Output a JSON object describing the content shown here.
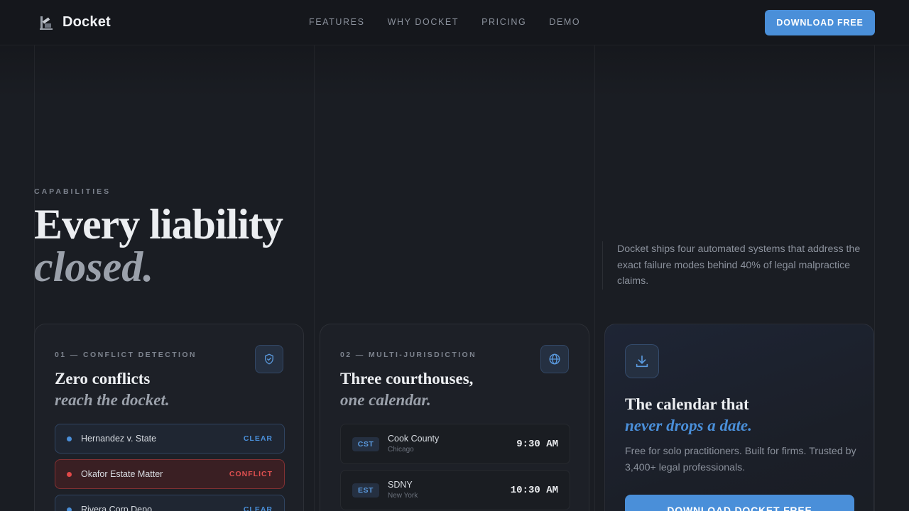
{
  "nav": {
    "brand": "Docket",
    "links": [
      "FEATURES",
      "WHY DOCKET",
      "PRICING",
      "DEMO"
    ],
    "cta": "DOWNLOAD FREE"
  },
  "hero": {
    "eyebrow": "CAPABILITIES",
    "title_main": "Every liability",
    "title_em": "closed.",
    "description": "Docket ships four automated systems that address the exact failure modes behind 40% of legal malpractice claims."
  },
  "cards": {
    "conflict": {
      "eyebrow": "01 — CONFLICT DETECTION",
      "title_main": "Zero conflicts",
      "title_em": "reach the docket.",
      "icon": "shield-check-icon",
      "matters": [
        {
          "name": "Hernandez v. State",
          "status": "CLEAR"
        },
        {
          "name": "Okafor Estate Matter",
          "status": "CONFLICT"
        },
        {
          "name": "Rivera Corp Depo",
          "status": "CLEAR"
        }
      ]
    },
    "jurisdiction": {
      "eyebrow": "02 — MULTI-JURISDICTION",
      "title_main": "Three courthouses,",
      "title_em": "one calendar.",
      "icon": "globe-icon",
      "courts": [
        {
          "tz": "CST",
          "name": "Cook County",
          "city": "Chicago",
          "time": "9:30 AM"
        },
        {
          "tz": "EST",
          "name": "SDNY",
          "city": "New York",
          "time": "10:30 AM"
        }
      ]
    },
    "cta": {
      "icon": "download-icon",
      "title_main": "The calendar that",
      "title_em": "never drops a date.",
      "description": "Free for solo practitioners. Built for firms. Trusted by 3,400+ legal professionals.",
      "button": "DOWNLOAD DOCKET FREE"
    }
  },
  "colors": {
    "background": "#1a1d23",
    "accent": "#4a8fd9",
    "conflict": "#e05050"
  }
}
